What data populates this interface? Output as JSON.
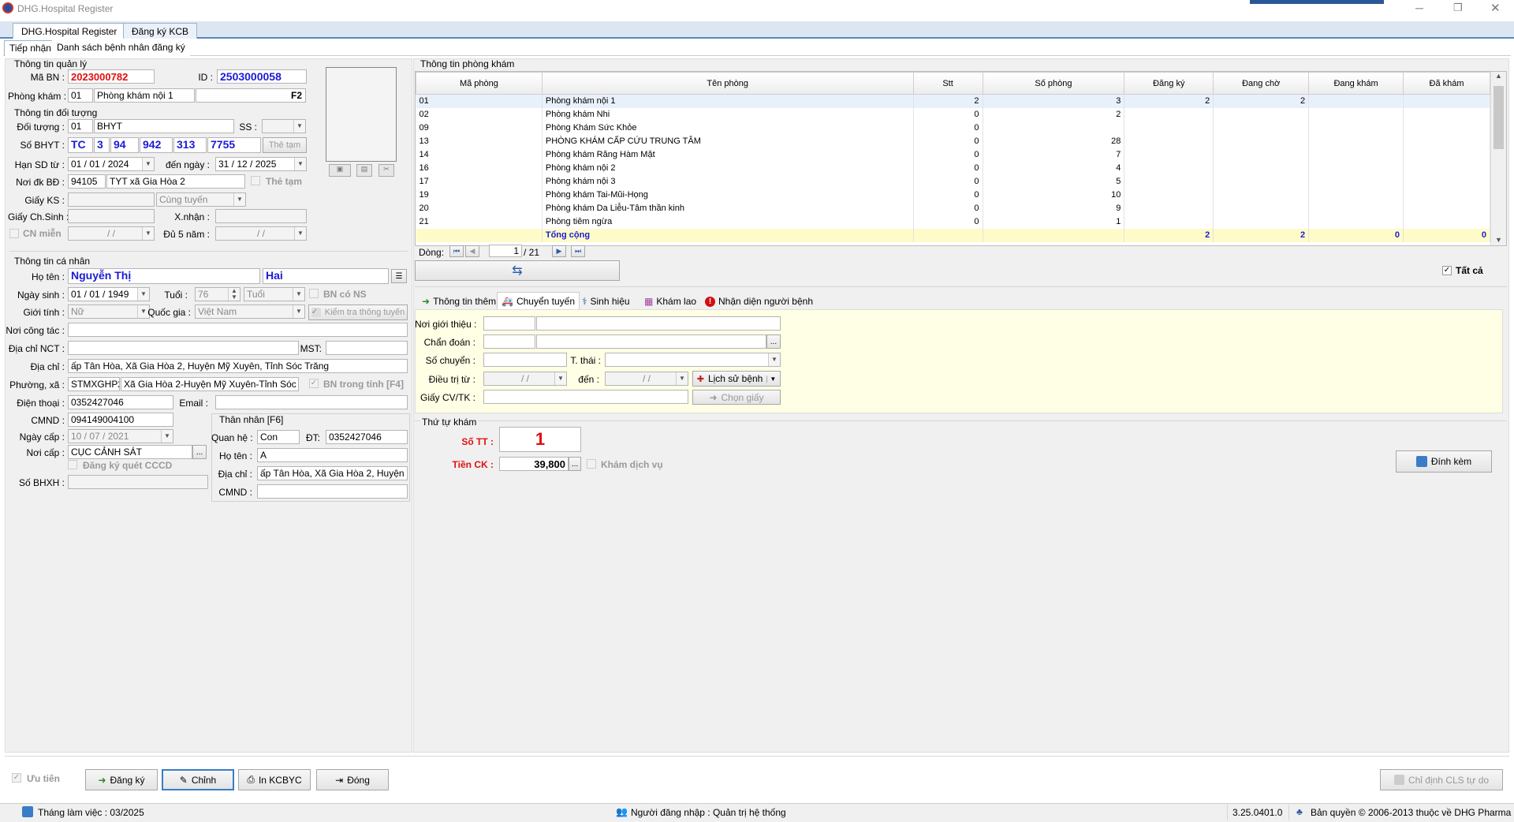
{
  "window": {
    "title": "DHG.Hospital Register"
  },
  "main_tabs": [
    "DHG.Hospital Register",
    "Đăng ký KCB"
  ],
  "sub_tabs": [
    "Tiếp nhận",
    "Danh sách bệnh nhân đăng ký"
  ],
  "quan_ly": {
    "group": "Thông tin quản lý",
    "ma_bn_label": "Mã BN :",
    "ma_bn": "2023000782",
    "id_label": "ID :",
    "id": "2503000058",
    "phong_kham_label": "Phòng khám :",
    "phong_kham_code": "01",
    "phong_kham_name": "Phòng khám nội 1",
    "f2": "F2"
  },
  "doi_tuong": {
    "group": "Thông tin đối tượng",
    "doi_tuong_label": "Đối tượng :",
    "doi_tuong_code": "01",
    "doi_tuong_name": "BHYT",
    "ss_label": "SS :",
    "so_bhyt_label": "Số BHYT :",
    "bhyt_parts": [
      "TC",
      "3",
      "94",
      "942",
      "313",
      "7755"
    ],
    "the_tam_btn": "Thẻ tạm",
    "han_sd_label": "Hạn SD từ :",
    "han_sd_from": "01 / 01 / 2024",
    "den_ngay_label": "đến ngày :",
    "han_sd_to": "31 / 12 / 2025",
    "noi_dk_label": "Nơi đk BĐ :",
    "noi_dk_code": "94105",
    "noi_dk_name": "TYT xã Gia Hòa 2",
    "the_tam_chk": "Thẻ tạm",
    "giay_ks_label": "Giấy KS :",
    "cung_tuyen": "Cùng tuyến",
    "giay_cs_label": "Giấy Ch.Sinh :",
    "x_nhan_label": "X.nhận :",
    "cn_mien_label": "CN miễn",
    "date_blank": "/ /",
    "du_5nam_label": "Đủ 5 năm :"
  },
  "ca_nhan": {
    "group": "Thông tin cá nhân",
    "ho_ten_label": "Họ tên :",
    "ho": "Nguyễn Thị",
    "ten": "Hai",
    "ngay_sinh_label": "Ngày sinh :",
    "ngay_sinh": "01 / 01 / 1949",
    "tuoi_label": "Tuổi :",
    "tuoi": "76",
    "tuoi_unit": "Tuổi",
    "bn_co_ns": "BN có NS",
    "gioi_tinh_label": "Giới tính :",
    "gioi_tinh": "Nữ",
    "quoc_gia_label": "Quốc gia :",
    "quoc_gia": "Việt Nam",
    "kiem_tra_btn": "Kiểm tra thông tuyến",
    "noi_cong_tac_label": "Nơi công tác :",
    "dia_chi_nct_label": "Địa chỉ  NCT :",
    "mst_label": "MST:",
    "dia_chi_label": "Địa chỉ :",
    "dia_chi": "ấp Tân Hòa, Xã Gia Hòa 2, Huyện Mỹ Xuyên, Tỉnh Sóc Trăng",
    "phuong_xa_label": "Phường, xã :",
    "phuong_xa_code": "STMXGHP2",
    "phuong_xa_name": "Xã Gia Hòa 2-Huyện Mỹ Xuyên-Tỉnh Sóc Trăng",
    "bn_trong_tinh": "BN trong tỉnh [F4]",
    "dien_thoai_label": "Điện thoại :",
    "dien_thoai": "0352427046",
    "email_label": "Email :",
    "cmnd_label": "CMND :",
    "cmnd": "094149004100",
    "ngay_cap_label": "Ngày cấp :",
    "ngay_cap": "10 / 07 / 2021",
    "noi_cap_label": "Nơi cấp :",
    "noi_cap": "CỤC CẢNH SÁT",
    "dk_cccd": "Đăng ký quét CCCD",
    "so_bhxh_label": "Số BHXH :"
  },
  "than_nhan": {
    "group": "Thân nhân [F6]",
    "quan_he_label": "Quan hệ :",
    "quan_he": "Con",
    "dt_label": "ĐT:",
    "dt": "0352427046",
    "ho_ten_label": "Họ tên :",
    "ho_ten": "A",
    "dia_chi_label": "Địa chỉ :",
    "dia_chi": "ấp Tân Hòa, Xã Gia Hòa 2, Huyện Mỹ",
    "cmnd_label": "CMND :"
  },
  "phong_kham": {
    "group": "Thông tin phòng khám",
    "columns": [
      "Mã phòng",
      "Tên phòng",
      "Stt",
      "Số phòng",
      "Đăng ký",
      "Đang chờ",
      "Đang khám",
      "Đã khám"
    ],
    "rows": [
      [
        "01",
        "Phòng khám nội 1",
        "2",
        "3",
        "2",
        "2",
        "",
        ""
      ],
      [
        "02",
        "Phòng khám Nhi",
        "0",
        "2",
        "",
        "",
        "",
        ""
      ],
      [
        "09",
        "Phòng Khám Sức Khỏe",
        "0",
        "",
        "",
        "",
        "",
        ""
      ],
      [
        "13",
        "PHÒNG KHÁM CẤP CỨU TRUNG TÂM",
        "0",
        "28",
        "",
        "",
        "",
        ""
      ],
      [
        "14",
        "Phòng khám Răng Hàm Mặt",
        "0",
        "7",
        "",
        "",
        "",
        ""
      ],
      [
        "16",
        "Phòng khám nội 2",
        "0",
        "4",
        "",
        "",
        "",
        ""
      ],
      [
        "17",
        "Phòng khám nội 3",
        "0",
        "5",
        "",
        "",
        "",
        ""
      ],
      [
        "19",
        "Phòng khám Tai-Mũi-Họng",
        "0",
        "10",
        "",
        "",
        "",
        ""
      ],
      [
        "20",
        "Phòng khám Da Liễu-Tâm thần kinh",
        "0",
        "9",
        "",
        "",
        "",
        ""
      ],
      [
        "21",
        "Phòng tiêm ngừa",
        "0",
        "1",
        "",
        "",
        "",
        ""
      ]
    ],
    "total_label": "Tổng cộng",
    "total": [
      "2",
      "2",
      "0",
      "0"
    ],
    "dong_label": "Dòng:",
    "page": "1",
    "pages": "/ 21",
    "tat_ca": "Tất cả"
  },
  "info_tabs": [
    "Thông tin thêm",
    "Chuyển tuyến",
    "Sinh hiệu",
    "Khám lao",
    "Nhận diện người bệnh"
  ],
  "chuyen_tuyen": {
    "noi_gioi_thieu": "Nơi giới thiệu :",
    "chan_doan": "Chẩn đoán :",
    "so_chuyen": "Số chuyển :",
    "t_thai": "T. thái :",
    "dieu_tri_tu": "Điều trị từ :",
    "den": "đến :",
    "date_blank": "/ /",
    "lich_su_btn": "Lịch sử bệnh",
    "giay_cv": "Giấy CV/TK :",
    "chon_giay_btn": "Chọn giấy"
  },
  "thu_tu": {
    "group": "Thứ tự khám",
    "so_tt_label": "Số TT :",
    "so_tt": "1",
    "tien_ck_label": "Tiền CK :",
    "tien_ck": "39,800",
    "kham_dv": "Khám dịch vụ",
    "dinh_kem_btn": "Đính kèm"
  },
  "actions": {
    "uu_tien": "Ưu tiên",
    "dang_ky": "Đăng ký",
    "chinh": "Chỉnh",
    "in_kcbyc": "In KCBYC",
    "dong": "Đóng",
    "chi_dinh_cls": "Chỉ định CLS tự do"
  },
  "status": {
    "thang": "Tháng làm việc : 03/2025",
    "nguoi_dn": "Người đăng nhập : Quản trị hệ thống",
    "version": "3.25.0401.0",
    "copyright": "Bản quyền © 2006-2013 thuộc về DHG Pharma"
  },
  "colors": {
    "title_blue": "#1b1bd6",
    "id_red": "#e01010",
    "highlight_yellow": "#fffbc8",
    "panel_yellow": "#ffffe6"
  }
}
